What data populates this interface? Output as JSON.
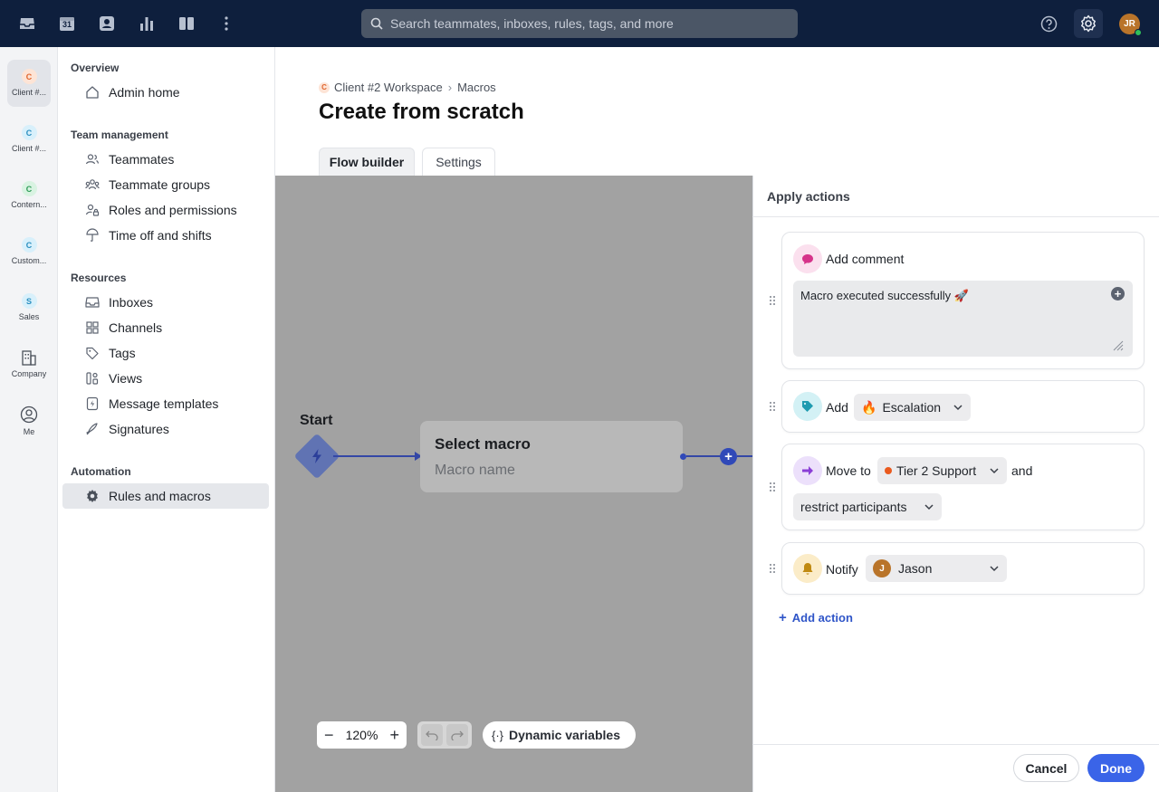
{
  "topbar": {
    "search_placeholder": "Search teammates, inboxes, rules, tags, and more",
    "calendar_day": "31",
    "user_initials": "JR",
    "icons": [
      "inbox-icon",
      "calendar-icon",
      "contacts-icon",
      "analytics-icon",
      "split-view-icon",
      "more-icon",
      "help-icon",
      "gear-icon"
    ]
  },
  "workspaces": [
    {
      "initial": "C",
      "label": "Client #...",
      "badge_bg": "#fde4d6",
      "badge_fg": "#e0642c",
      "active": true
    },
    {
      "initial": "C",
      "label": "Client #...",
      "badge_bg": "#d8f0fb",
      "badge_fg": "#2a8fc0"
    },
    {
      "initial": "C",
      "label": "Contern...",
      "badge_bg": "#d9f3e2",
      "badge_fg": "#2f9c58"
    },
    {
      "initial": "C",
      "label": "Custom...",
      "badge_bg": "#d8f0fb",
      "badge_fg": "#2a8fc0"
    },
    {
      "initial": "S",
      "label": "Sales",
      "badge_bg": "#d8f0fb",
      "badge_fg": "#2a8fc0"
    },
    {
      "label": "Company",
      "icon": "building-icon"
    },
    {
      "label": "Me",
      "icon": "user-circle-icon"
    }
  ],
  "nav": {
    "overview": "Overview",
    "admin_home": "Admin home",
    "team_management": "Team management",
    "teammates": "Teammates",
    "teammate_groups": "Teammate groups",
    "roles": "Roles and permissions",
    "time_off": "Time off and shifts",
    "resources": "Resources",
    "inboxes": "Inboxes",
    "channels": "Channels",
    "tags": "Tags",
    "views": "Views",
    "message_templates": "Message templates",
    "signatures": "Signatures",
    "automation": "Automation",
    "rules_macros": "Rules and macros"
  },
  "main": {
    "crumb_initial": "C",
    "crumb_workspace": "Client #2 Workspace",
    "crumb_page": "Macros",
    "title": "Create from scratch",
    "tab_flow": "Flow builder",
    "tab_settings": "Settings"
  },
  "canvas": {
    "start_label": "Start",
    "macro_title": "Select macro",
    "macro_placeholder": "Macro name",
    "zoom": "120%",
    "dynamic_variables": "Dynamic variables"
  },
  "panel": {
    "header": "Apply actions",
    "comment_label": "Add comment",
    "comment_text": "Macro executed successfully 🚀",
    "add_label": "Add",
    "tag_emoji": "🔥",
    "tag_name": "Escalation",
    "move_label": "Move to",
    "inbox_name": "Tier 2 Support",
    "and_label": "and",
    "restrict_label": "restrict participants",
    "notify_label": "Notify",
    "notify_initial": "J",
    "notify_name": "Jason",
    "add_action": "Add action",
    "cancel": "Cancel",
    "done": "Done"
  },
  "colors": {
    "topbar": "#0e1f3d",
    "accent": "#3a64e8",
    "canvas": "#a2a2a2",
    "flow": "#3049b8"
  }
}
